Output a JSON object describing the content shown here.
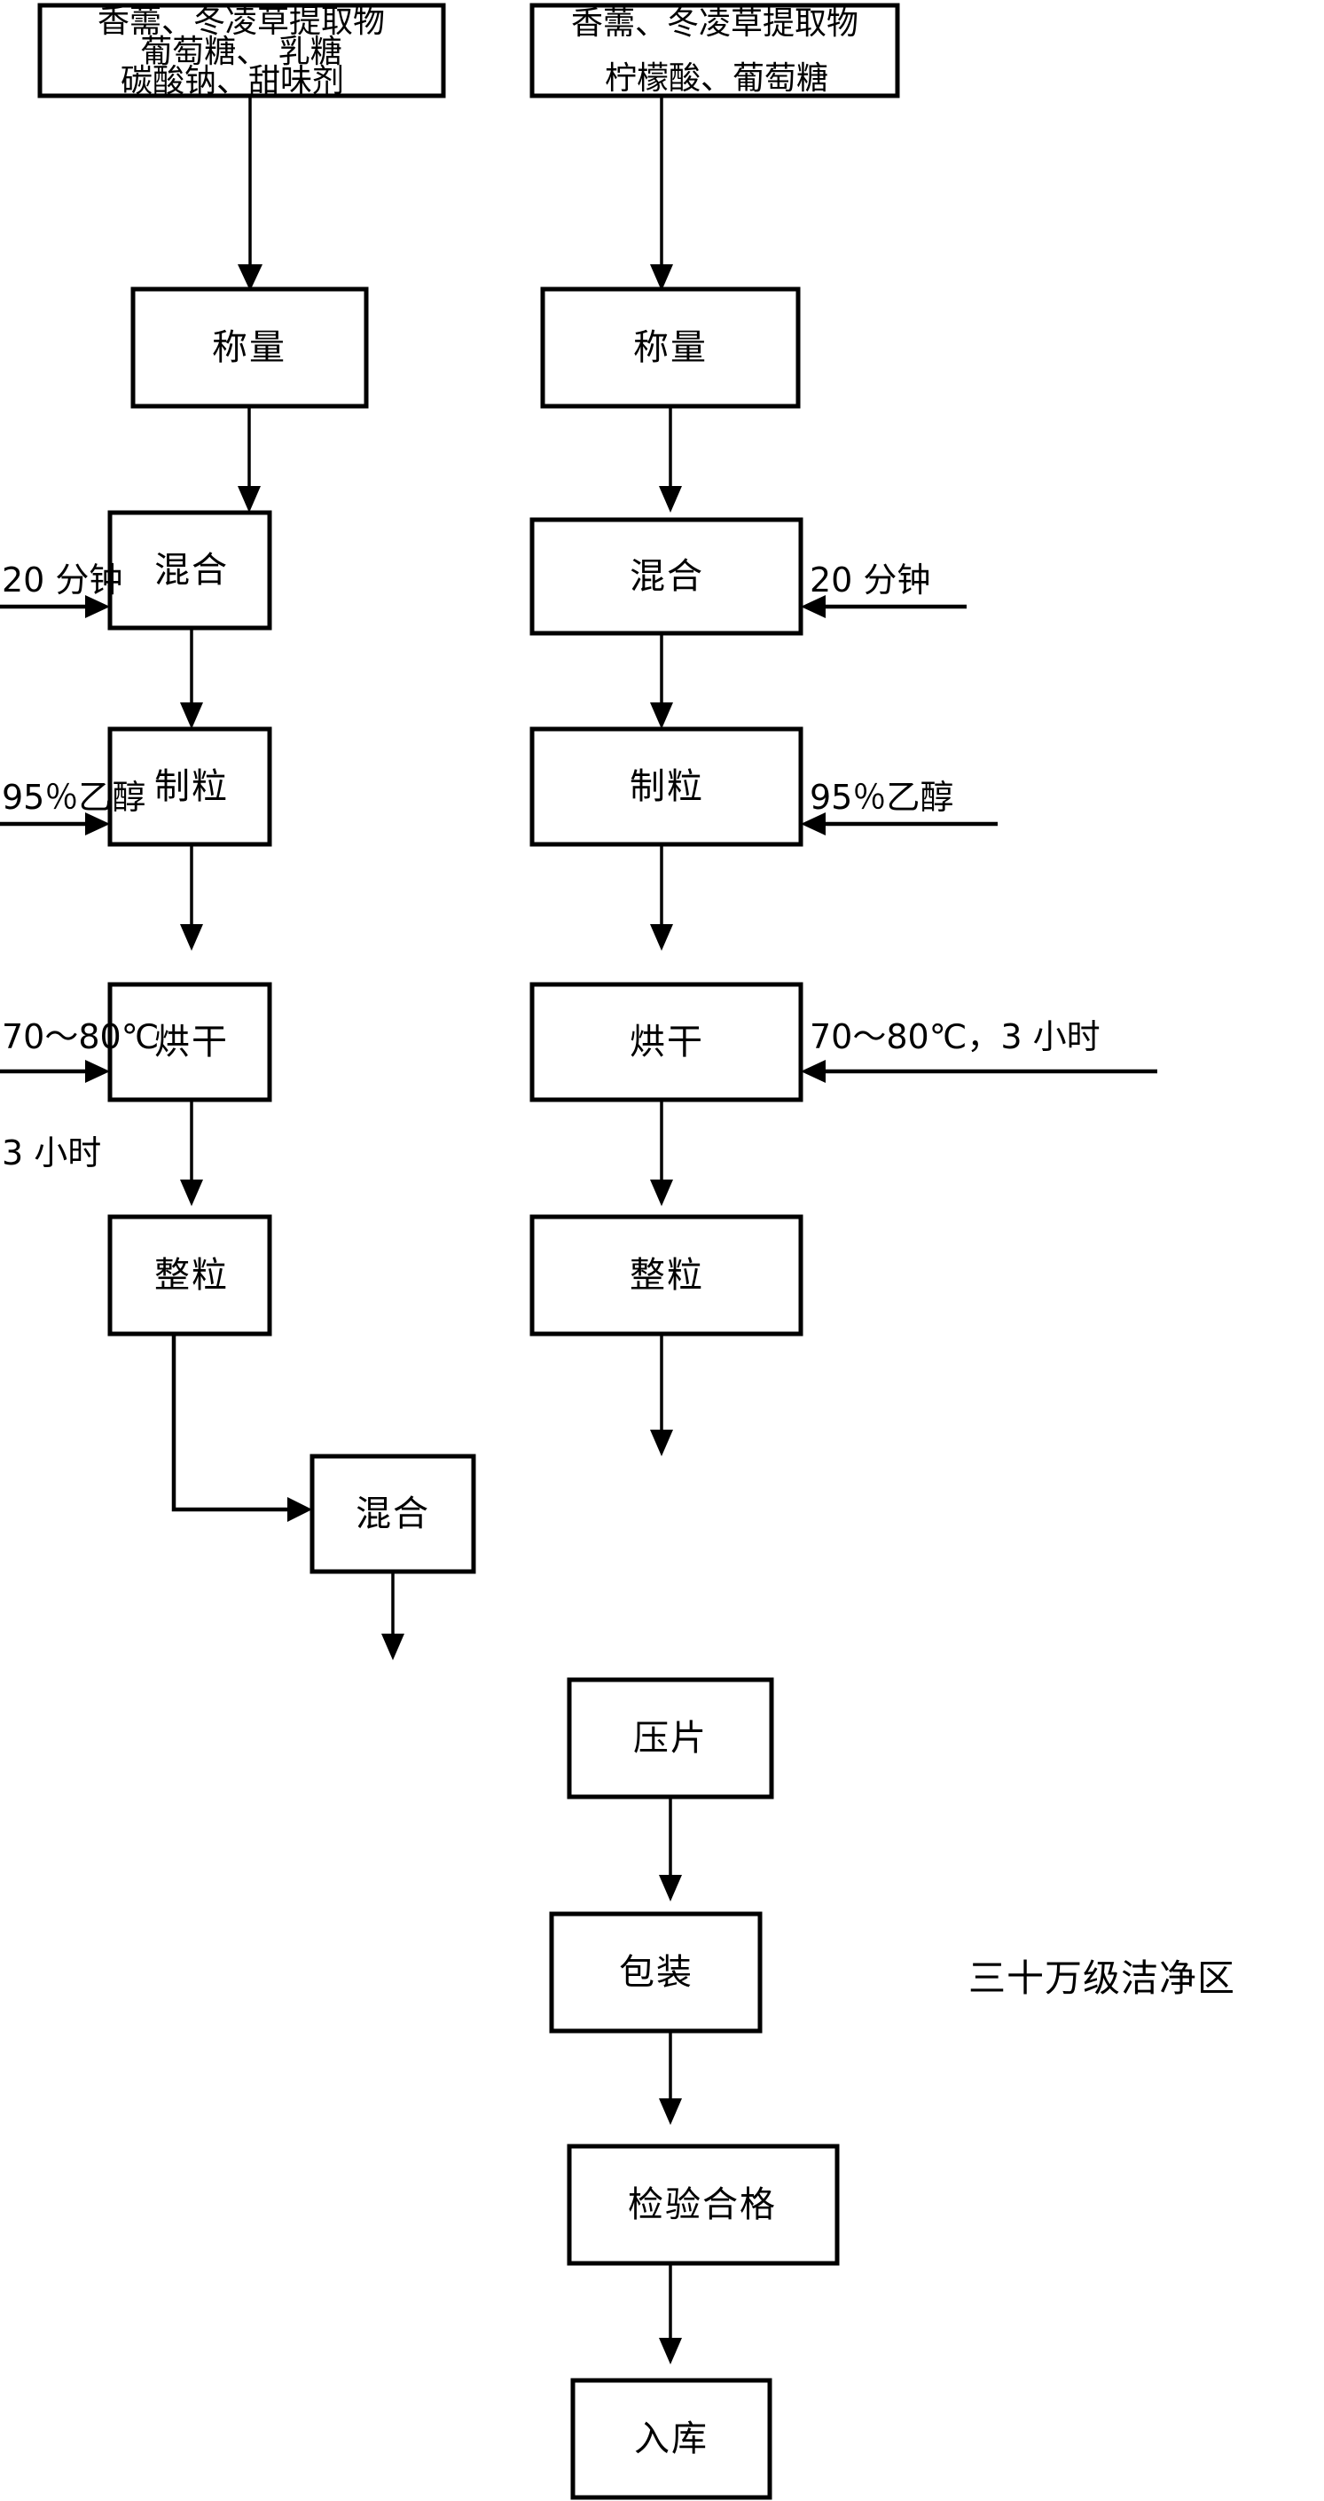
{
  "diagram": {
    "title_annotation": "三十万级洁净区",
    "left_branch": {
      "materials_box": {
        "lines": [
          "香薷、冬凌草提取物",
          "葡萄糖、 乳糖",
          "碳酸钠、甜味剂"
        ]
      },
      "steps": [
        {
          "id": "weigh",
          "label": "称量"
        },
        {
          "id": "mix",
          "label": "混合"
        },
        {
          "id": "granulate",
          "label": "制粒"
        },
        {
          "id": "dry",
          "label": "烘干"
        },
        {
          "id": "size",
          "label": "整粒"
        }
      ],
      "side_labels": [
        {
          "id": "mix-time",
          "text": "20 分钟"
        },
        {
          "id": "ethanol",
          "text": "95％乙醇"
        },
        {
          "id": "dry-temp",
          "text": "70～80℃"
        },
        {
          "id": "dry-time",
          "text": "3 小时"
        }
      ]
    },
    "right_branch": {
      "materials_box": {
        "lines": [
          "香薷、冬凌草提取物",
          "柠檬酸、葡萄糖"
        ]
      },
      "steps": [
        {
          "id": "weigh",
          "label": "称量"
        },
        {
          "id": "mix",
          "label": "混合"
        },
        {
          "id": "granulate",
          "label": "制粒"
        },
        {
          "id": "dry",
          "label": "烘干"
        },
        {
          "id": "size",
          "label": "整粒"
        }
      ],
      "side_labels": [
        {
          "id": "mix-time",
          "text": "20 分钟"
        },
        {
          "id": "ethanol",
          "text": "95％乙醇"
        },
        {
          "id": "dry-temp-time",
          "text": "70～80℃，3 小时"
        }
      ]
    },
    "merged_steps": [
      {
        "id": "final-mix",
        "label": "混合"
      },
      {
        "id": "tablet",
        "label": "压片"
      },
      {
        "id": "package",
        "label": "包装"
      },
      {
        "id": "inspect",
        "label": "检验合格"
      },
      {
        "id": "warehouse",
        "label": "入库"
      }
    ]
  }
}
